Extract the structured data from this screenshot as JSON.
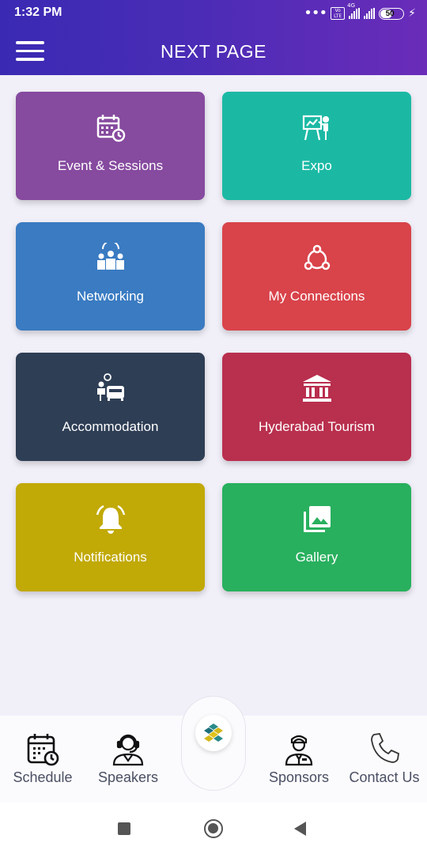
{
  "status": {
    "time": "1:32 PM",
    "dots": "•••",
    "volte": "Vo LTE",
    "network": "4G",
    "battery": "50",
    "battery_level": 0.5
  },
  "header": {
    "title": "NEXT PAGE"
  },
  "tiles": [
    {
      "label": "Event & Sessions",
      "icon": "calendar-clock-icon",
      "color": "#864a9f"
    },
    {
      "label": "Expo",
      "icon": "presentation-icon",
      "color": "#1bb9a4"
    },
    {
      "label": "Networking",
      "icon": "group-icon",
      "color": "#3a7bc2"
    },
    {
      "label": "My Connections",
      "icon": "share-network-icon",
      "color": "#d9434a"
    },
    {
      "label": "Accommodation",
      "icon": "hotel-reception-icon",
      "color": "#2e3e55"
    },
    {
      "label": "Hyderabad Tourism",
      "icon": "monument-icon",
      "color": "#b92f4e"
    },
    {
      "label": "Notifications",
      "icon": "alarm-bell-icon",
      "color": "#c1a906"
    },
    {
      "label": "Gallery",
      "icon": "photo-gallery-icon",
      "color": "#28b05e"
    }
  ],
  "bottom_nav": [
    {
      "label": "Schedule",
      "icon": "calendar-clock-icon"
    },
    {
      "label": "Speakers",
      "icon": "speaker-headset-icon"
    },
    {
      "label": "Sponsors",
      "icon": "sponsor-person-icon"
    },
    {
      "label": "Contact Us",
      "icon": "phone-icon"
    }
  ],
  "center_button": {
    "icon": "app-logo-icon"
  },
  "system_nav": {
    "recents": "square-icon",
    "home": "circle-icon",
    "back": "triangle-back-icon"
  }
}
